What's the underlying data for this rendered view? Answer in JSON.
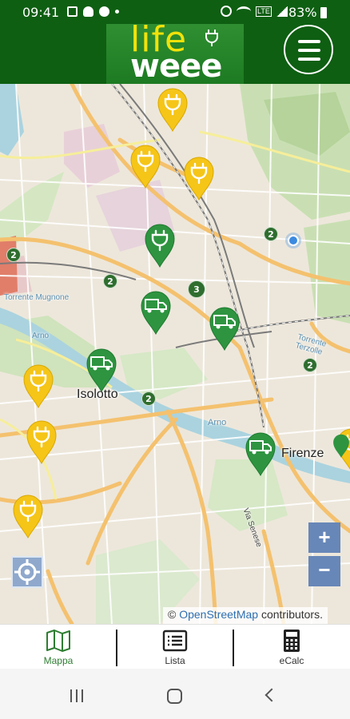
{
  "status_bar": {
    "time": "09:41",
    "battery": "83%",
    "network": "LTE"
  },
  "header": {
    "logo_top": "life",
    "logo_bottom": "weee",
    "menu_icon": "hamburger-icon"
  },
  "map": {
    "labels": {
      "isolotto": "Isolotto",
      "firenze": "Firenze",
      "arno": "Arno",
      "arno_small": "Arno",
      "torrente_mugnone": "Torrente Mugnone",
      "torrente_terzolle": "Torrente Terzolle",
      "via_senese": "Via Senese"
    },
    "clusters": [
      "2",
      "2",
      "2",
      "3",
      "2",
      "2",
      "2"
    ],
    "zoom_in_label": "+",
    "zoom_out_label": "−",
    "attribution_prefix": "©",
    "attribution_link": "OpenStreetMap",
    "attribution_suffix": "contributors.",
    "colors": {
      "pin_yellow": "#f5c518",
      "pin_green": "#2e9440",
      "header_green": "#0e5f12"
    }
  },
  "bottom_nav": {
    "items": [
      {
        "label": "Mappa",
        "icon": "map-icon",
        "active": true
      },
      {
        "label": "Lista",
        "icon": "list-icon",
        "active": false
      },
      {
        "label": "eCalc",
        "icon": "calculator-icon",
        "active": false
      }
    ]
  }
}
